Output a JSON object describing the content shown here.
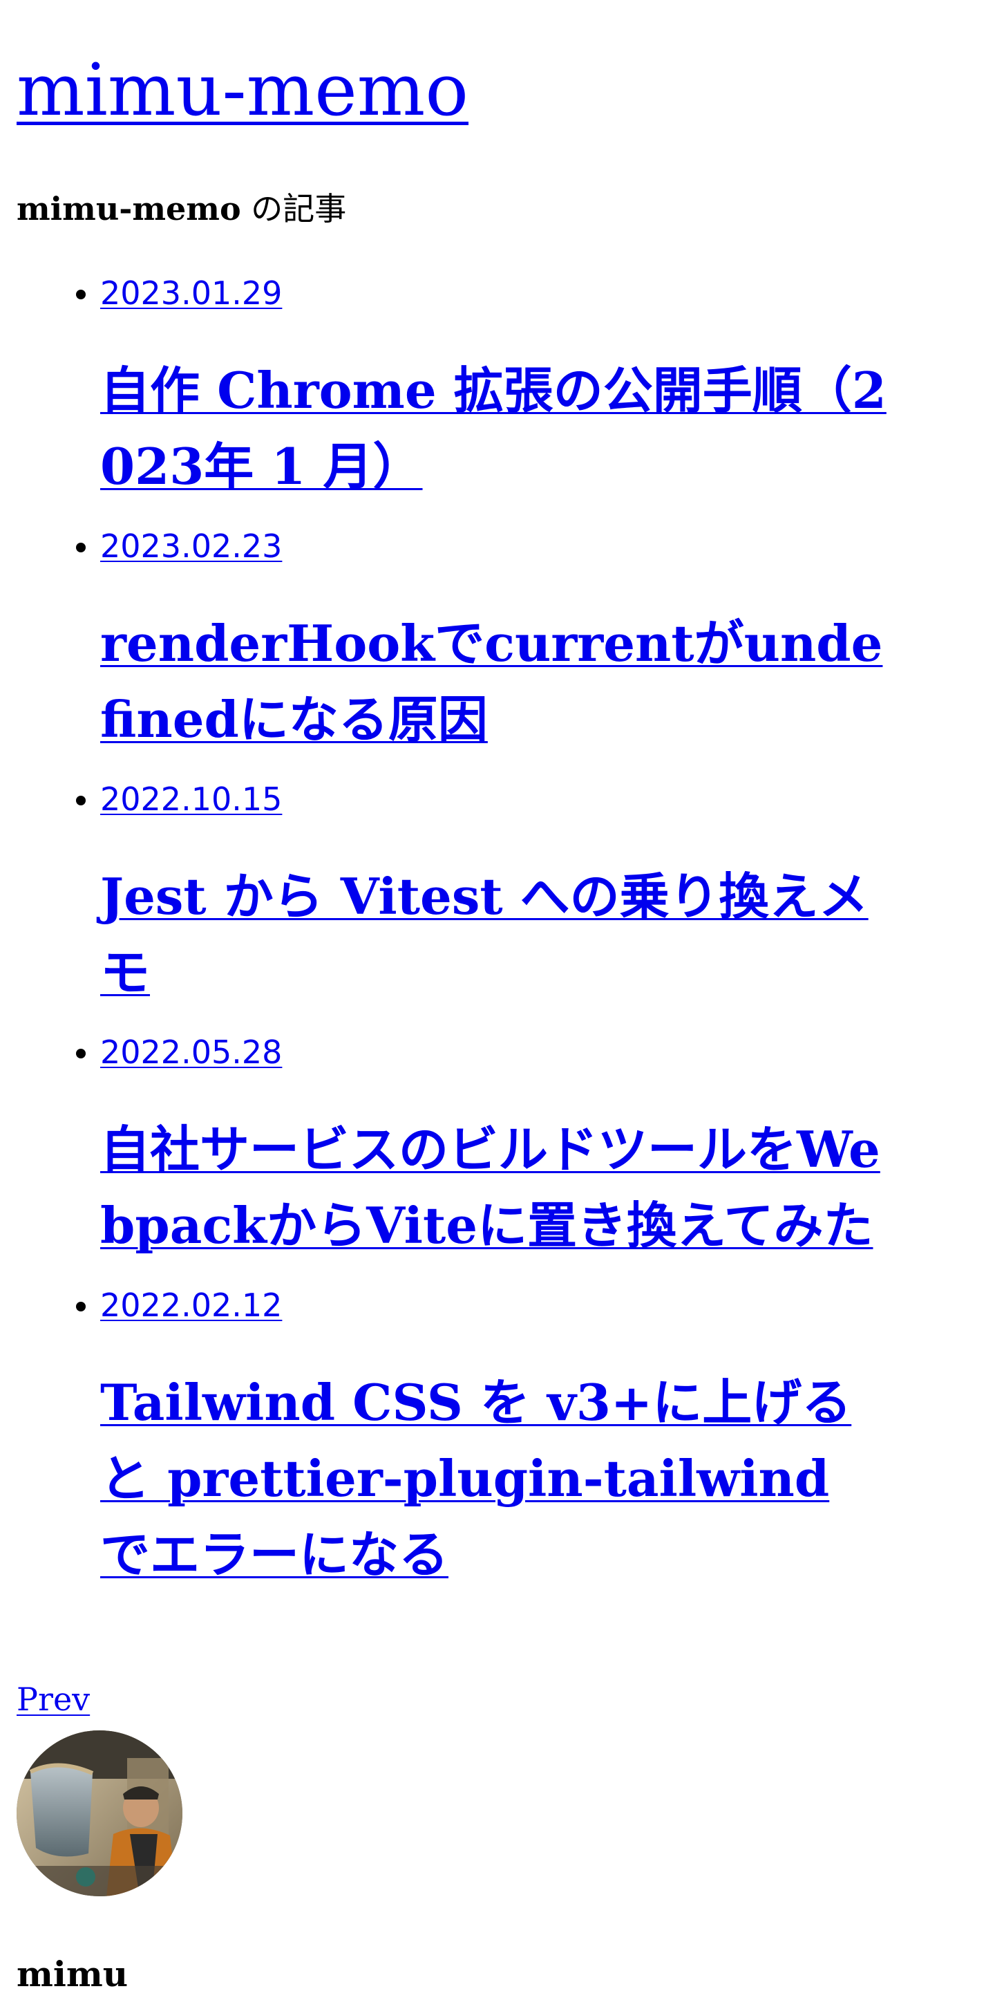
{
  "site": {
    "title": "mimu-memo"
  },
  "subtitle": {
    "name": "mimu-memo",
    "suffix": " の記事"
  },
  "posts": [
    {
      "date": "2023.01.29",
      "title": "自作 Chrome 拡張の公開手順（2023年 1 月）"
    },
    {
      "date": "2023.02.23",
      "title": "renderHookでcurrentがundefinedになる原因"
    },
    {
      "date": "2022.10.15",
      "title": "Jest から Vitest への乗り換えメモ"
    },
    {
      "date": "2022.05.28",
      "title": "自社サービスのビルドツールをWebpackからViteに置き換えてみた"
    },
    {
      "date": "2022.02.12",
      "title": "Tailwind CSS を v3+に上げると prettier-plugin-tailwind でエラーになる"
    }
  ],
  "pager": {
    "prev_label": "Prev"
  },
  "author": {
    "name": "mimu"
  },
  "colors": {
    "link": "#0000ee",
    "text": "#000000",
    "background": "#ffffff"
  }
}
